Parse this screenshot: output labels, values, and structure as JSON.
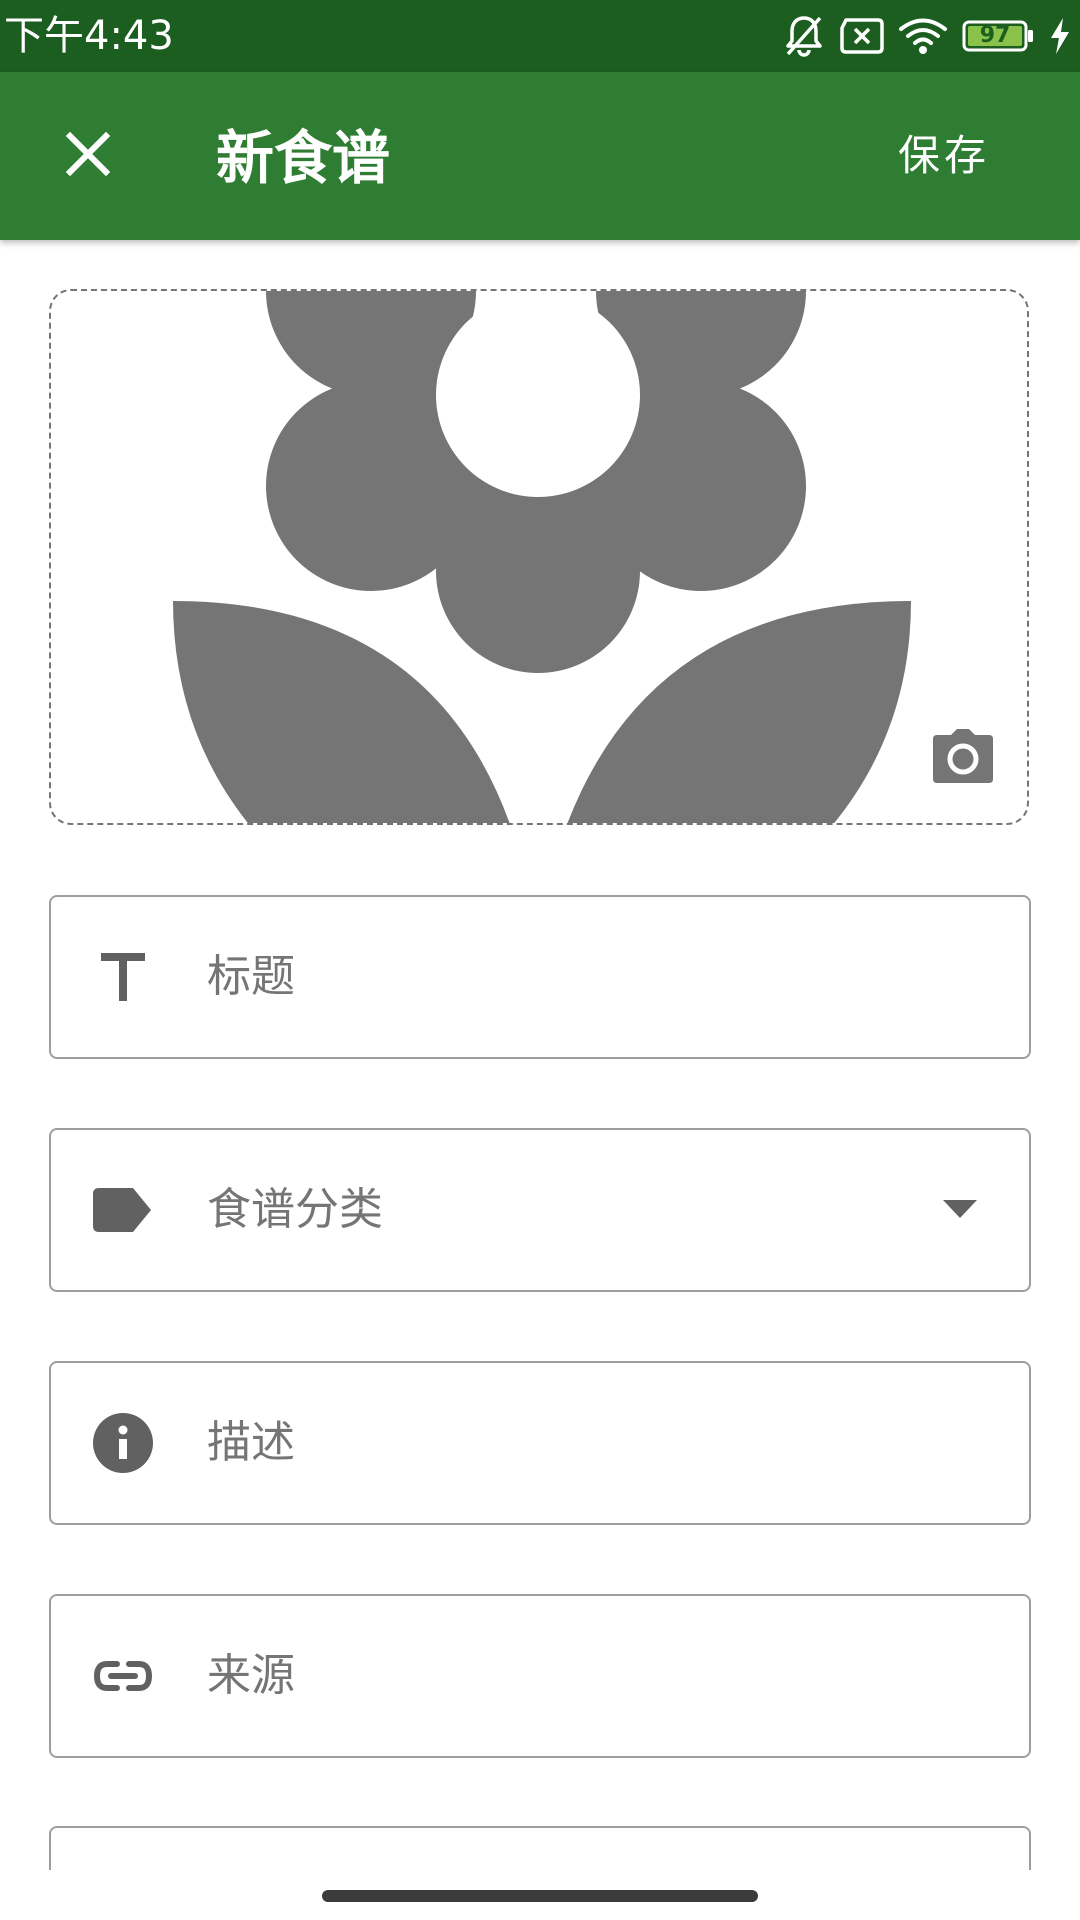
{
  "status_bar": {
    "time": "下午4:43",
    "battery_level": "97",
    "icons": [
      "bell-off-icon",
      "sim-off-icon",
      "wifi-icon",
      "battery-icon",
      "charging-icon"
    ]
  },
  "app_bar": {
    "close_icon": "close-icon",
    "title": "新食谱",
    "save_label": "保存",
    "color": "#2e7d32",
    "status_color": "#1b5e20"
  },
  "image_picker": {
    "placeholder_icon": "flower-icon",
    "camera_icon": "camera-icon"
  },
  "fields": {
    "title": {
      "icon": "title-icon",
      "label": "标题"
    },
    "category": {
      "icon": "label-icon",
      "label": "食谱分类",
      "dropdown_icon": "dropdown-arrow-icon"
    },
    "description": {
      "icon": "info-icon",
      "label": "描述"
    },
    "source": {
      "icon": "link-icon",
      "label": "来源"
    }
  }
}
